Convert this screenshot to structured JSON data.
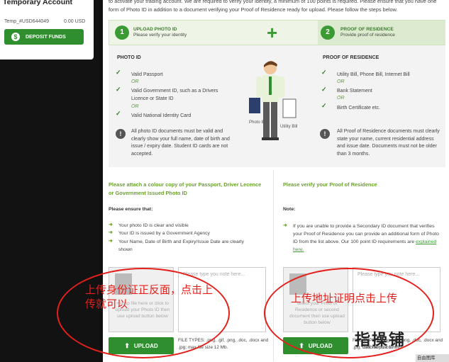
{
  "account": {
    "title": "Temporary Account",
    "id": "Temp_#USD644049",
    "balance": "0.00 USD",
    "deposit_label": "DEPOSIT FUNDS"
  },
  "intro": "to activate your trading account. We are required to verify your identity, a minimum of 100 points is required. Please ensure that you have one form of Photo ID in addition to a document verifying your Proof of Residence ready for upload. Please follow the steps below.",
  "steps": [
    {
      "num": "1",
      "title": "UPLOAD PHOTO ID",
      "sub": "Please verify your identity"
    },
    {
      "num": "2",
      "title": "PROOF OF RESIDENCE",
      "sub": "Provide proof of residence"
    }
  ],
  "photo_id": {
    "title": "PHOTO ID",
    "items": [
      "Valid Passport",
      "Valid Government ID, such as a Drivers Licence or State ID",
      "Valid National Identity Card"
    ],
    "or": "OR",
    "note": "All photo ID documents must be valid and clearly show your full name, date of birth and issue / expiry date. Student ID cards are not accepted."
  },
  "residence": {
    "title": "PROOF OF RESIDENCE",
    "items": [
      "Utility Bill, Phone Bill, Internet Bill",
      "Bank Statement",
      "Birth Certificate etc."
    ],
    "or": "OR",
    "note": "All Proof of Residence documents must clearly state your name, current residential address and issue date. Documents must not be older than 3 months."
  },
  "illustration": {
    "card_label": "Photo ID",
    "bill_label": "Utility Bill"
  },
  "upload_left": {
    "title": "Please attach a colour copy of your Passport, Driver Lecence or Government Issued Photo ID",
    "ensure": "Please ensure that:",
    "bullets": [
      "Your photo ID is clear and visible",
      "Your ID is issued by a Government Agency",
      "Your Name, Date of Birth and Expiry/Issue Date are clearly shown"
    ],
    "drop_text": "+ drop file here or click to upload your Photo ID then use upload button below",
    "note_placeholder": "Please type you note here...",
    "upload_label": "UPLOAD",
    "filetypes": "FILE TYPES: .png, .gif, .png, .doc, .docx and .jpg; max file size 12 Mb."
  },
  "upload_right": {
    "title": "Please verify your Proof of Residence",
    "note_title": "Note:",
    "bullet": "If you are unable to provide a Secondary ID document that verifies your Proof of Residence you can provide an additional form of Photo ID from the list above. Our 100 point ID requirements are",
    "link": "explained here.",
    "drop_text": "select your Proof of Residence or second document then use upload button below",
    "note_placeholder": "Please type you note here...",
    "upload_label": "UPLOAD",
    "filetypes": "FILE TYPES: .png, .gif, .png, .doc, .docx and .jpg; max file size 12 Mb."
  },
  "annotations": {
    "left": "上传身份证正反面，点击上传就可以",
    "right": "上传地址证明点击上传"
  },
  "watermark": {
    "text": "指操铺",
    "sub": "zhibiaopu.com"
  },
  "corner_text": "自由图库",
  "colors": {
    "brand_green": "#2f8f2f",
    "accent_green": "#6aa329",
    "annotation_red": "#e3201b"
  }
}
